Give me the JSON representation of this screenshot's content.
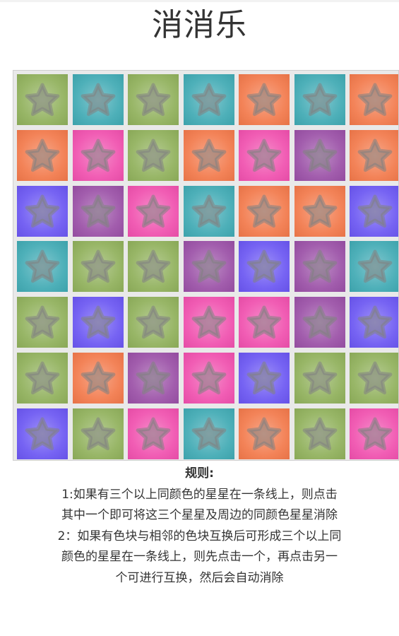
{
  "title": "消消乐",
  "colors": {
    "green": "#8fb05a",
    "teal": "#3fa9b3",
    "orange": "#f2784a",
    "pink": "#f04fae",
    "purple": "#9a4fa6",
    "blue": "#6a55f2"
  },
  "tile_icon": "star-icon",
  "board": {
    "rows": [
      [
        "green",
        "teal",
        "green",
        "teal",
        "orange",
        "teal",
        "orange"
      ],
      [
        "orange",
        "pink",
        "green",
        "orange",
        "pink",
        "purple",
        "orange"
      ],
      [
        "blue",
        "purple",
        "pink",
        "teal",
        "orange",
        "orange",
        "blue"
      ],
      [
        "teal",
        "green",
        "green",
        "purple",
        "blue",
        "purple",
        "teal"
      ],
      [
        "green",
        "blue",
        "green",
        "pink",
        "pink",
        "purple",
        "blue"
      ],
      [
        "green",
        "orange",
        "purple",
        "pink",
        "blue",
        "green",
        "green"
      ],
      [
        "blue",
        "green",
        "pink",
        "teal",
        "orange",
        "green",
        "pink"
      ]
    ]
  },
  "rules": {
    "heading": "规则:",
    "rule1": "1:如果有三个以上同颜色的星星在一条线上，则点击其中一个即可将这三个星星及周边的同颜色星星消除",
    "rule2": "2：如果有色块与相邻的色块互换后可形成三个以上同颜色的星星在一条线上，则先点击一个，再点击另一个可进行互换，然后会自动消除"
  }
}
